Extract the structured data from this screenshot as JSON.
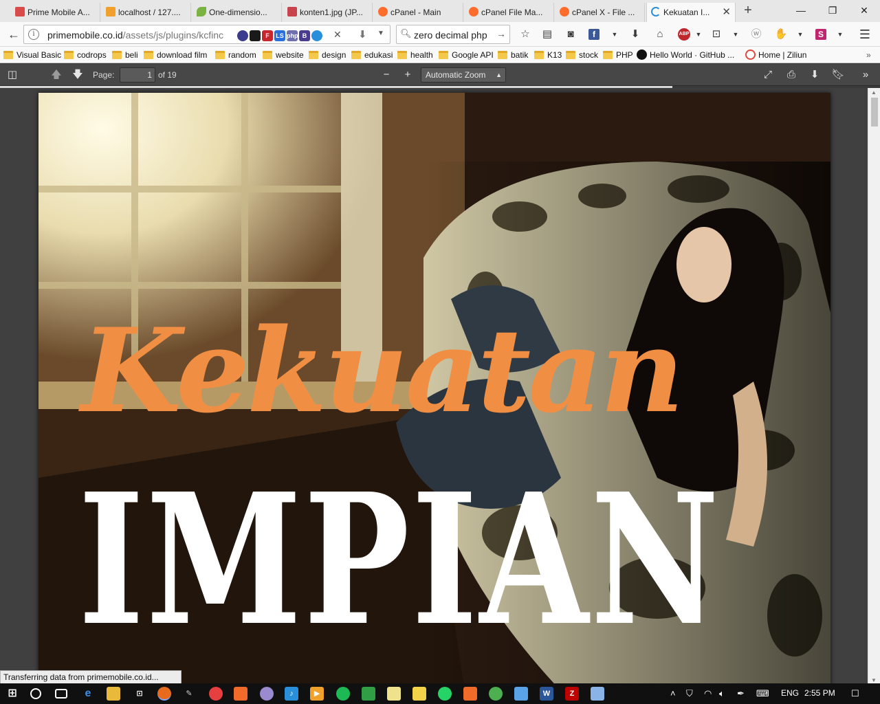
{
  "tabs": [
    {
      "label": "Prime Mobile A...",
      "favicon_color": "#d94b4b"
    },
    {
      "label": "localhost / 127....",
      "favicon_color": "#f1a12b"
    },
    {
      "label": "One-dimensio...",
      "favicon_color": "#7bb342"
    },
    {
      "label": "konten1.jpg (JP...",
      "favicon_color": "#c9434c"
    },
    {
      "label": "cPanel - Main",
      "favicon_color": "#ff6c2c"
    },
    {
      "label": "cPanel File Ma...",
      "favicon_color": "#ff6c2c"
    },
    {
      "label": "cPanel X - File ...",
      "favicon_color": "#ff6c2c"
    },
    {
      "label": "Kekuatan I...",
      "favicon_color": "#2a8fdb",
      "active": true
    }
  ],
  "window": {
    "minimize": "—",
    "restore": "❐",
    "close": "✕",
    "new_tab": "+"
  },
  "nav": {
    "url_host": "primemobile.co.id",
    "url_path": "/assets/js/plugins/kcfinc",
    "info_icon": "i",
    "search_value": "zero decimal php",
    "clear": "✕"
  },
  "bookmarks": [
    {
      "label": "Visual Basic",
      "type": "folder"
    },
    {
      "label": "codrops",
      "type": "folder"
    },
    {
      "label": "beli",
      "type": "folder"
    },
    {
      "label": "download film",
      "type": "folder"
    },
    {
      "label": "random",
      "type": "folder"
    },
    {
      "label": "website",
      "type": "folder"
    },
    {
      "label": "design",
      "type": "folder"
    },
    {
      "label": "edukasi",
      "type": "folder"
    },
    {
      "label": "health",
      "type": "folder"
    },
    {
      "label": "Google API",
      "type": "folder"
    },
    {
      "label": "batik",
      "type": "folder"
    },
    {
      "label": "K13",
      "type": "folder"
    },
    {
      "label": "stock",
      "type": "folder"
    },
    {
      "label": "PHP",
      "type": "folder"
    },
    {
      "label": "Hello World · GitHub ...",
      "type": "github"
    },
    {
      "label": "Home | Ziliun",
      "type": "site"
    }
  ],
  "pdf": {
    "page_label": "Page:",
    "current_page": "1",
    "page_count_text": "of 19",
    "zoom_value": "Automatic Zoom",
    "load_progress": 0.764,
    "title_script": "Kekuatan",
    "title_block": "IMPIAN"
  },
  "status_text": "Transferring data from primemobile.co.id...",
  "taskbar": {
    "language": "ENG",
    "clock": "2:55 PM"
  },
  "colors": {
    "accent_orange": "#f08f43",
    "pdf_toolbar": "#474747",
    "viewer_bg": "#404040"
  }
}
